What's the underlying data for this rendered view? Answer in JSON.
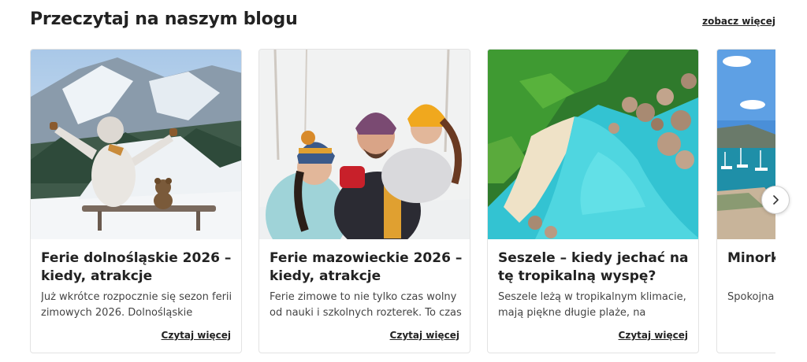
{
  "section": {
    "title": "Przeczytaj na naszym blogu",
    "see_more": "zobacz więcej"
  },
  "cards": [
    {
      "title": "Ferie dolnośląskie 2026 – kiedy, atrakcje",
      "excerpt": "Już wkrótce rozpocznie się sezon ferii zimowych 2026. Dolnośląskie szkoły…",
      "read_more": "Czytaj więcej"
    },
    {
      "title": "Ferie mazowieckie 2026 – kiedy, atrakcje",
      "excerpt": "Ferie zimowe to nie tylko czas wolny od nauki i szkolnych rozterek. To czas na…",
      "read_more": "Czytaj więcej"
    },
    {
      "title": "Seszele – kiedy jechać na tę tropikalną wyspę?",
      "excerpt": "Seszele leżą w tropikalnym klimacie, mają piękne długie plaże, na których…",
      "read_more": "Czytaj więcej"
    },
    {
      "title": "Minorka – wyspie",
      "excerpt": "Spokojna długości –",
      "read_more": ""
    }
  ],
  "icons": {
    "next": "chevron-right-icon"
  }
}
